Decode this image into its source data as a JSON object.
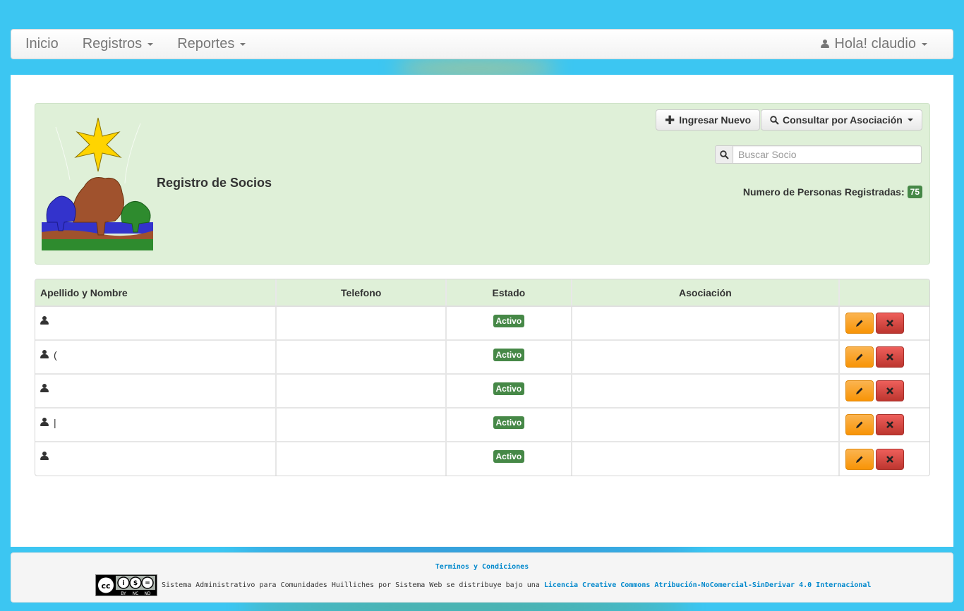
{
  "navbar": {
    "inicio": "Inicio",
    "registros": "Registros",
    "reportes": "Reportes",
    "user_greeting": "Hola! claudio"
  },
  "panel": {
    "title": "Registro de Socios",
    "btn_new": "Ingresar Nuevo",
    "btn_assoc": "Consultar por Asociación",
    "search_placeholder": "Buscar Socio",
    "count_label": "Numero de Personas Registradas:",
    "count_value": "75"
  },
  "table": {
    "headers": [
      "Apellido y Nombre",
      "Telefono",
      "Estado",
      "Asociación",
      ""
    ],
    "rows": [
      {
        "name": "",
        "telefono": "",
        "estado": "Activo",
        "asociacion": ""
      },
      {
        "name": "(",
        "telefono": "",
        "estado": "Activo",
        "asociacion": ""
      },
      {
        "name": "",
        "telefono": "",
        "estado": "Activo",
        "asociacion": ""
      },
      {
        "name": "|",
        "telefono": "",
        "estado": "Activo",
        "asociacion": ""
      },
      {
        "name": "",
        "telefono": "",
        "estado": "Activo",
        "asociacion": ""
      }
    ]
  },
  "footer": {
    "terms": "Terminos y Condiciones",
    "license_text": "Sistema Administrativo para Comunidades Huilliches por Sistema Web se distribuye bajo una",
    "license_link": "Licencia Creative Commons Atribución-NoComercial-SinDerivar 4.0 Internacional",
    "cc_badge_labels": [
      "BY",
      "NC",
      "ND"
    ]
  },
  "icons": {
    "user": "user-icon",
    "plus": "plus-icon",
    "search": "search-icon",
    "edit": "pencil-icon",
    "delete": "close-icon"
  },
  "colors": {
    "page_bg": "#3cc6f2",
    "panel_bg": "#dff0d8",
    "badge_green": "#468847",
    "edit_orange": "#f89406",
    "delete_red": "#bd362f",
    "link_blue": "#0088cc"
  }
}
